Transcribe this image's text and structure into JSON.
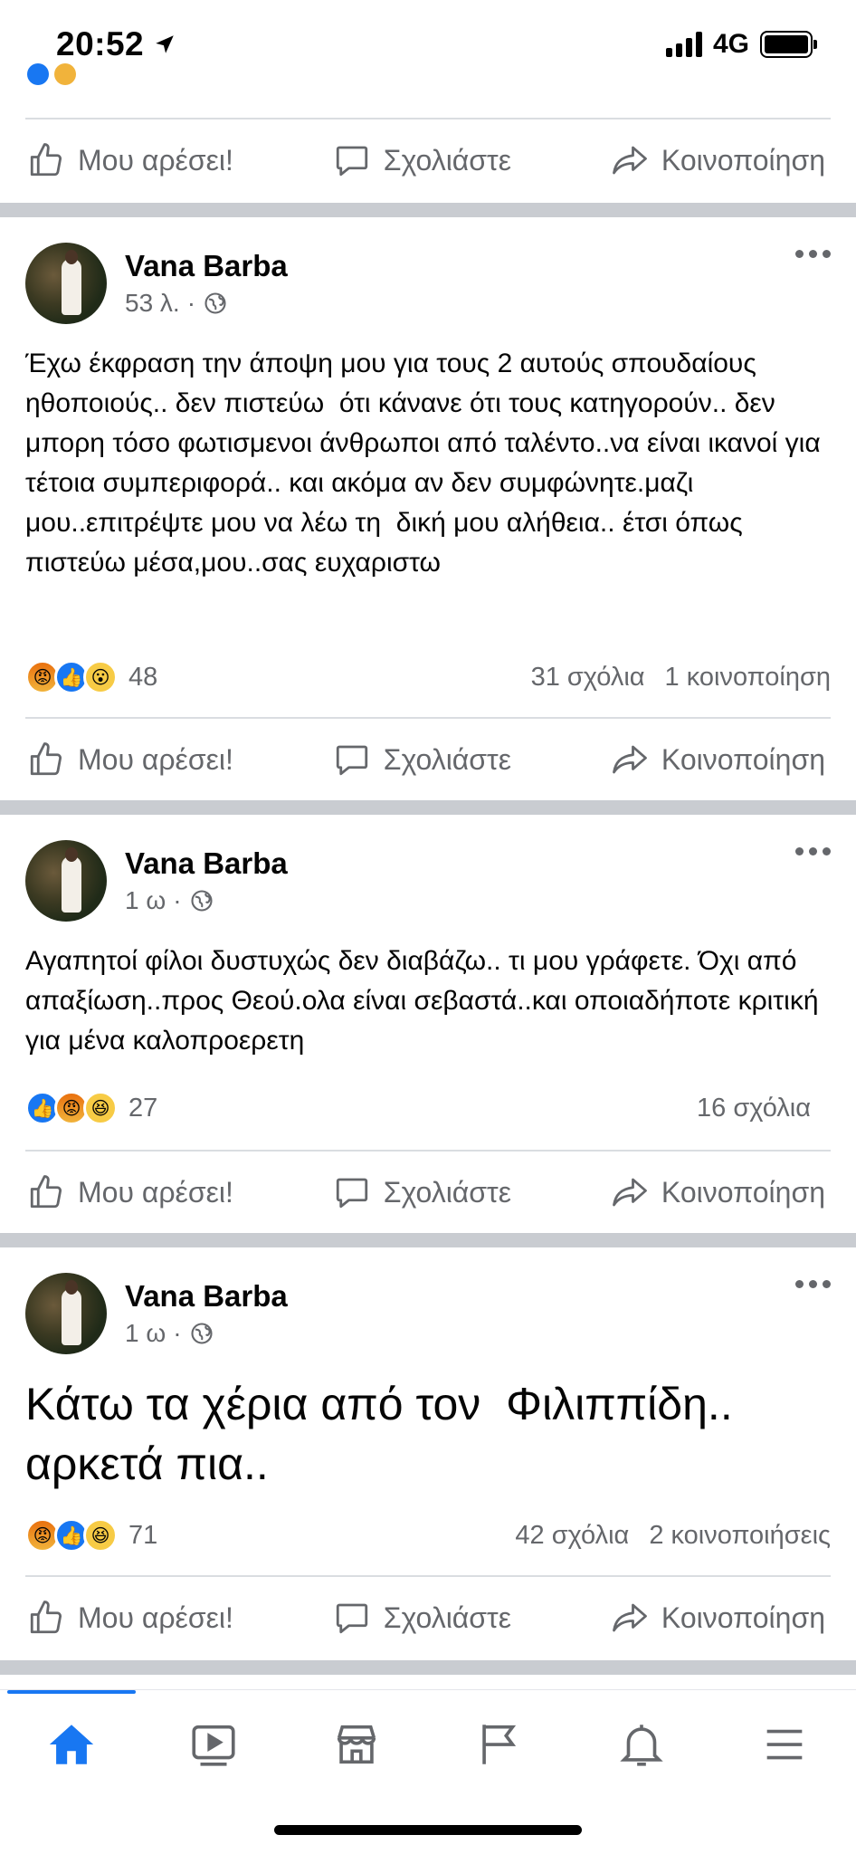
{
  "status_bar": {
    "time": "20:52",
    "network": "4G"
  },
  "actions": {
    "like": "Μου αρέσει!",
    "comment": "Σχολιάστε",
    "share": "Κοινοποίηση"
  },
  "posts": [
    {
      "author": "Vana Barba",
      "time": "53 λ.",
      "text": "Έχω έκφραση την άποψη μου για τους 2 αυτούς σπουδαίους ηθοποιούς.. δεν πιστεύω  ότι κάνανε ότι τους κατηγορούν.. δεν μπορη τόσο φωτισμενοι άνθρωποι από ταλέντο..να είναι ικανοί για τέτοια συμπεριφορά.. και ακόμα αν δεν συμφώνητε.μαζι μου..επιτρέψτε μου να λέω τη  δική μου αλήθεια.. έτσι όπως πιστεύω μέσα,μου..σας ευχαριστω",
      "reactions": [
        "angry",
        "like",
        "wow"
      ],
      "reaction_count": "48",
      "comments": "31 σχόλια",
      "shares": "1 κοινοποίηση"
    },
    {
      "author": "Vana Barba",
      "time": "1 ω",
      "text": "Αγαπητοί φίλοι δυστυχώς δεν διαβάζω.. τι μου γράφετε. Όχι από απαξίωση..προς Θεού.ολα είναι σεβαστά..και οποιαδήποτε κριτική για μένα καλοπροερετη",
      "reactions": [
        "like",
        "angry",
        "haha"
      ],
      "reaction_count": "27",
      "comments": "16 σχόλια",
      "shares": ""
    },
    {
      "author": "Vana Barba",
      "time": "1 ω",
      "text": "Κάτω τα χέρια από τον  Φιλιππίδη.. αρκετά πια..",
      "reactions": [
        "angry",
        "like",
        "haha"
      ],
      "reaction_count": "71",
      "comments": "42 σχόλια",
      "shares": "2 κοινοποιήσεις"
    }
  ],
  "bottom_nav": [
    "home-icon",
    "watch-icon",
    "marketplace-icon",
    "pages-flag-icon",
    "notifications-bell-icon",
    "menu-icon"
  ],
  "colors": {
    "accent": "#1877f2",
    "secondary_text": "#65676b",
    "separator": "#c9ccd1"
  }
}
